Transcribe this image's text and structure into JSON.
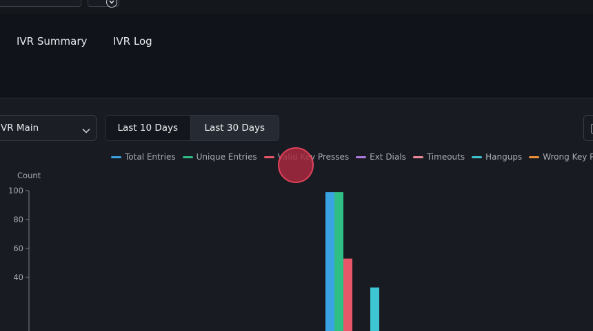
{
  "tabs": [
    {
      "label": "IVR Summary"
    },
    {
      "label": "IVR Log"
    }
  ],
  "filters": {
    "ivr_select_value": "VR Main",
    "range_buttons": [
      {
        "label": "Last 10 Days",
        "active": true
      },
      {
        "label": "Last 30 Days",
        "active": false
      }
    ]
  },
  "colors": {
    "total_entries": "#3aa3e3",
    "unique_entries": "#2fbf84",
    "valid_key_presses": "#e8566a",
    "ext_dials": "#b07be0",
    "timeouts": "#f08b9b",
    "hangups": "#3ec6d2",
    "wrong_key_presses": "#f0923a"
  },
  "chart_data": {
    "type": "bar",
    "ylabel": "Count",
    "y_ticks": [
      "100",
      "80",
      "60",
      "40"
    ],
    "ylim": [
      0,
      100
    ],
    "legend_position": "top",
    "series": [
      {
        "name": "Total Entries",
        "color_key": "total_entries",
        "values": [
          99
        ]
      },
      {
        "name": "Unique Entries",
        "color_key": "unique_entries",
        "values": [
          99
        ]
      },
      {
        "name": "Valid Key Presses",
        "color_key": "valid_key_presses",
        "values": [
          53
        ]
      },
      {
        "name": "Ext Dials",
        "color_key": "ext_dials",
        "values": [
          0
        ]
      },
      {
        "name": "Timeouts",
        "color_key": "timeouts",
        "values": [
          0
        ]
      },
      {
        "name": "Hangups",
        "color_key": "hangups",
        "values": [
          33
        ]
      },
      {
        "name": "Wrong Key Presses",
        "color_key": "wrong_key_presses",
        "values": [
          0
        ]
      }
    ]
  }
}
